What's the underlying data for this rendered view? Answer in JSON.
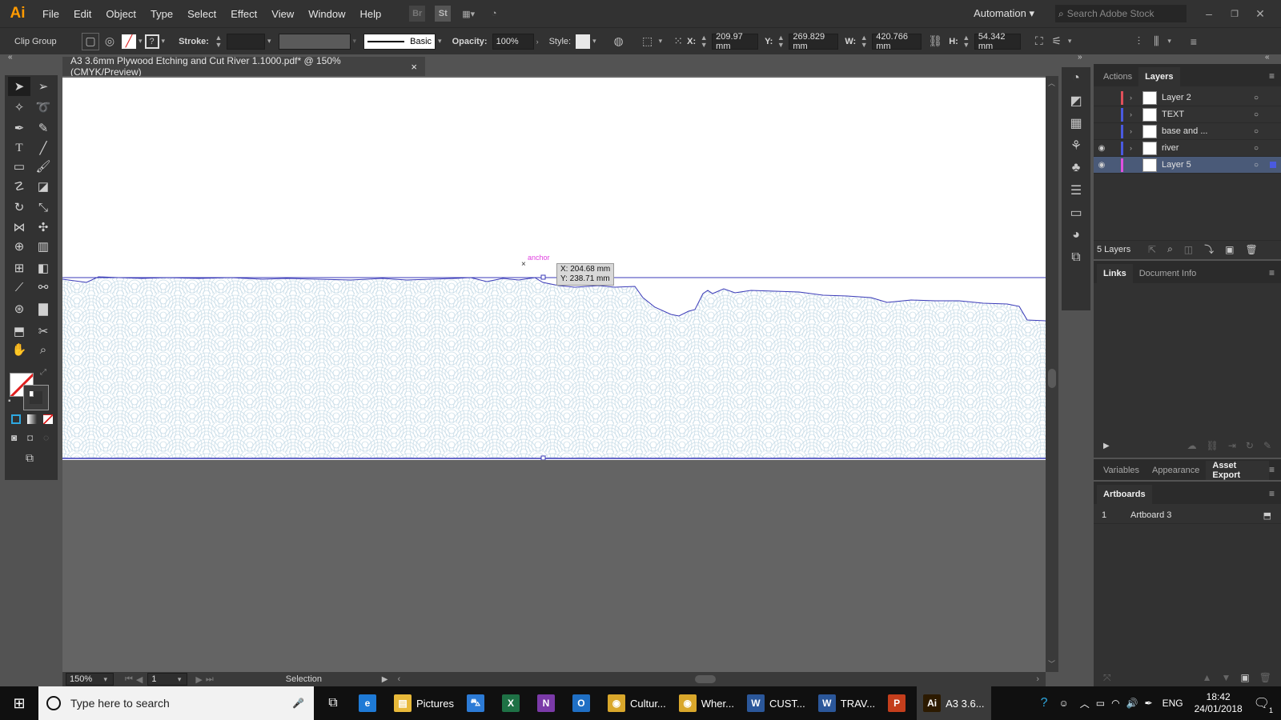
{
  "app": {
    "logo": "Ai",
    "menus": [
      "File",
      "Edit",
      "Object",
      "Type",
      "Select",
      "Effect",
      "View",
      "Window",
      "Help"
    ],
    "workspace": "Automation",
    "search_placeholder": "Search Adobe Stock"
  },
  "control_bar": {
    "selection_type": "Clip Group",
    "stroke_label": "Stroke:",
    "stroke_profile": "Basic",
    "opacity_label": "Opacity:",
    "opacity_value": "100%",
    "style_label": "Style:",
    "x_label": "X:",
    "x_value": "209.97 mm",
    "y_label": "Y:",
    "y_value": "269.829 mm",
    "w_label": "W:",
    "w_value": "420.766 mm",
    "h_label": "H:",
    "h_value": "54.342 mm"
  },
  "document": {
    "tab_title": "A3 3.6mm Plywood Etching and Cut River 1.1000.pdf* @ 150% (CMYK/Preview)",
    "close": "×"
  },
  "canvas": {
    "anchor_label": "anchor",
    "tooltip_x": "X: 204.68 mm",
    "tooltip_y": "Y: 238.71 mm",
    "colors": {
      "path": "#3a3ab8",
      "pattern": "#c9dde8",
      "anchor": "#e040e0"
    }
  },
  "status": {
    "zoom": "150%",
    "artboard_number": "1",
    "tool": "Selection"
  },
  "layers_panel": {
    "tabs": [
      "Actions",
      "Layers"
    ],
    "active_tab": "Layers",
    "layers": [
      {
        "name": "Layer 2",
        "visible": false,
        "color": "#e0505a",
        "expandable": true,
        "selected": false
      },
      {
        "name": "TEXT",
        "visible": false,
        "color": "#4a5ae0",
        "expandable": true,
        "selected": false
      },
      {
        "name": "base and ...",
        "visible": false,
        "color": "#4a5ae0",
        "expandable": true,
        "selected": false
      },
      {
        "name": "river",
        "visible": true,
        "color": "#4a5ae0",
        "expandable": true,
        "selected": false
      },
      {
        "name": "Layer 5",
        "visible": true,
        "color": "#e050e0",
        "expandable": false,
        "selected": true
      }
    ],
    "count": "5 Layers"
  },
  "links_panel": {
    "tabs": [
      "Links",
      "Document Info"
    ],
    "active_tab": "Links"
  },
  "export_panel": {
    "tabs": [
      "Variables",
      "Appearance",
      "Asset Export"
    ],
    "active_tab": "Asset Export"
  },
  "artboards_panel": {
    "title": "Artboards",
    "items": [
      {
        "number": "1",
        "name": "Artboard 3"
      }
    ]
  },
  "taskbar": {
    "search_placeholder": "Type here to search",
    "apps": [
      {
        "label": "",
        "icon": "e",
        "color": "#1e7ad6"
      },
      {
        "label": "Pictures",
        "icon": "▤",
        "color": "#e8b93a"
      },
      {
        "label": "",
        "icon": "⛍",
        "color": "#2c7bd6"
      },
      {
        "label": "",
        "icon": "X",
        "color": "#1e7145"
      },
      {
        "label": "",
        "icon": "N",
        "color": "#7b3aa8"
      },
      {
        "label": "",
        "icon": "O",
        "color": "#1f6fc4"
      },
      {
        "label": "Cultur...",
        "icon": "◉",
        "color": "#d9a72b"
      },
      {
        "label": "Wher...",
        "icon": "◉",
        "color": "#d9a72b"
      },
      {
        "label": "CUST...",
        "icon": "W",
        "color": "#2b579a"
      },
      {
        "label": "TRAV...",
        "icon": "W",
        "color": "#2b579a"
      },
      {
        "label": "",
        "icon": "P",
        "color": "#c43e1c"
      },
      {
        "label": "A3 3.6...",
        "icon": "Ai",
        "color": "#2c1a00"
      }
    ],
    "lang": "ENG",
    "time": "18:42",
    "date": "24/01/2018",
    "notifications": "1"
  }
}
